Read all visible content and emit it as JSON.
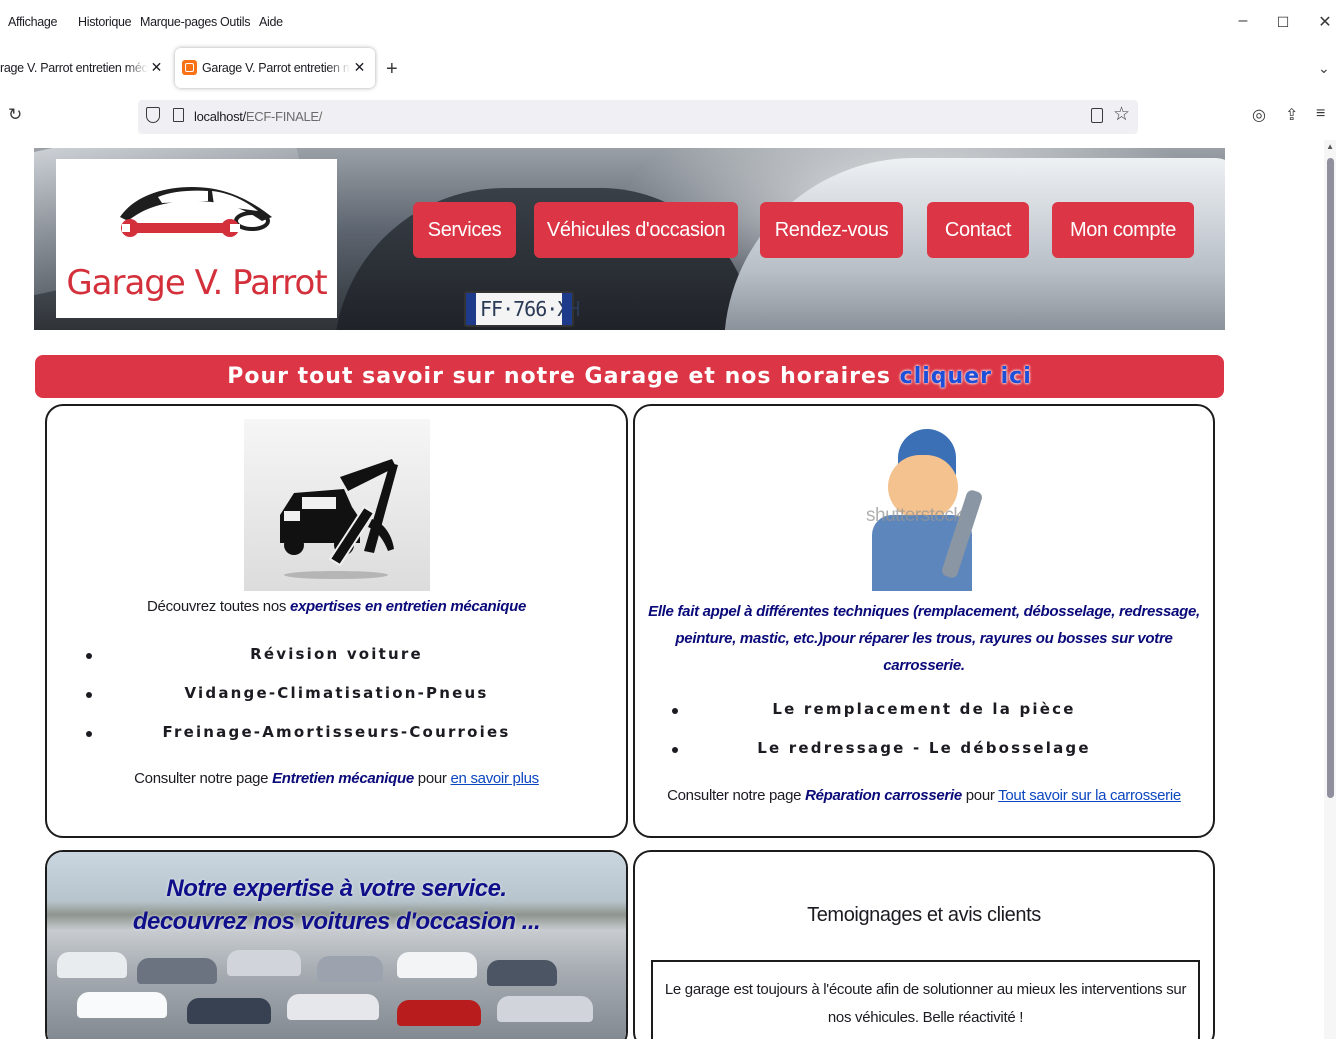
{
  "browser": {
    "menu": {
      "affichage": "Affichage",
      "historique": "Historique",
      "marque_pages": "Marque-pages",
      "outils": "Outils",
      "aide": "Aide"
    },
    "tabs": [
      {
        "title": "rage V. Parrot entretien méca"
      },
      {
        "title": "Garage V. Parrot entretien méca"
      }
    ],
    "url_host": "localhost/",
    "url_path": "ECF-FINALE/"
  },
  "header": {
    "logo_text": "Garage V. Parrot",
    "plate_text": "FF·766·XH",
    "nav": {
      "services": "Services",
      "vehicules": "Véhicules d'occasion",
      "rendez_vous": "Rendez-vous",
      "contact": "Contact",
      "compte": "Mon compte"
    }
  },
  "info_banner": {
    "text": "Pour tout savoir sur notre Garage et nos horaires ",
    "link": "cliquer ici"
  },
  "card_mecanique": {
    "intro_plain": "Découvrez toutes nos ",
    "intro_emph": "expertises en entretien mécanique",
    "items": [
      "Révision voiture",
      "Vidange-Climatisation-Pneus",
      "Freinage-Amortisseurs-Courroies"
    ],
    "footer_plain": "Consulter notre page ",
    "footer_emph": "Entretien mécanique",
    "footer_pour": " pour ",
    "footer_link": "en savoir plus"
  },
  "card_carrosserie": {
    "watermark": "shutterstock",
    "intro_line1": "Elle fait appel à différentes techniques (remplacement, débosselage, redressage,",
    "intro_line2": "peinture, mastic, etc.)pour réparer les trous, rayures ou bosses sur votre",
    "intro_line3": "carrosserie.",
    "items": [
      "Le remplacement de la pièce",
      "Le redressage - Le débosselage"
    ],
    "footer_plain": "Consulter notre page ",
    "footer_emph": "Réparation carrosserie",
    "footer_pour": " pour ",
    "footer_link": "Tout savoir sur la carrosserie"
  },
  "card_occasion": {
    "title_line1": "Notre expertise à votre service.",
    "title_line2": "decouvrez nos voitures d'occasion ..."
  },
  "card_avis": {
    "title": "Temoignages et avis clients",
    "review": "Le garage est toujours à l'écoute afin de solutionner au mieux les interventions sur nos véhicules. Belle réactivité !"
  },
  "colors": {
    "brand_red": "#dc3545",
    "link_blue": "#0d47c0",
    "emphasis_navy": "#0a0a7a"
  }
}
